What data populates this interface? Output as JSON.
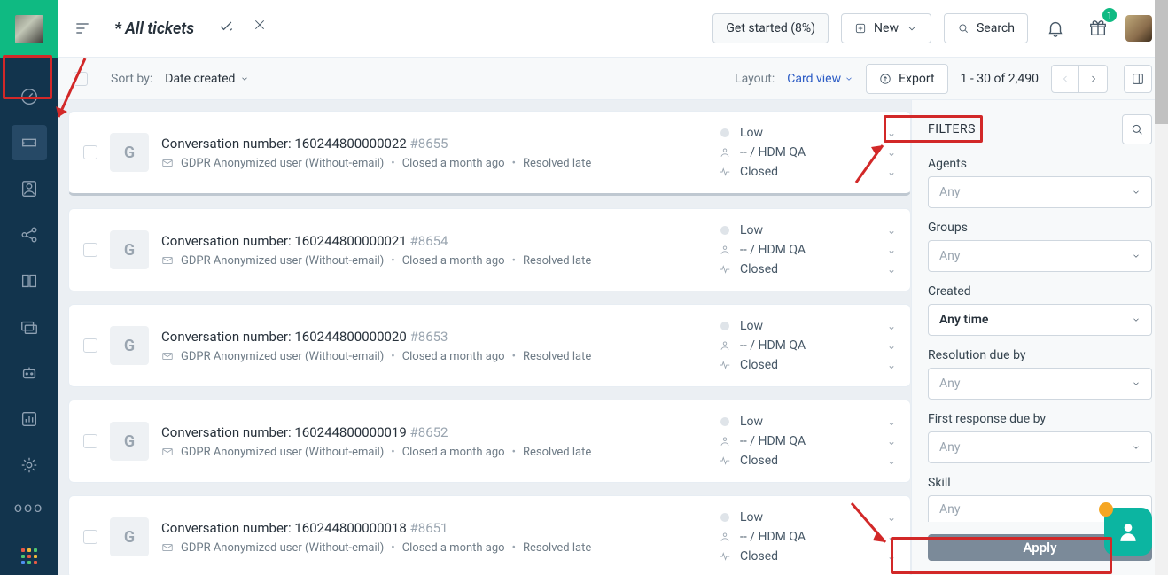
{
  "header": {
    "page_title": "* All tickets",
    "get_started_label": "Get started (8%)",
    "new_label": "New",
    "search_label": "Search",
    "gift_badge": "1"
  },
  "toolbar": {
    "sort_label": "Sort by:",
    "sort_value": "Date created",
    "layout_label": "Layout:",
    "layout_value": "Card view",
    "export_label": "Export",
    "pager": "1 - 30 of 2,490"
  },
  "filters": {
    "title": "FILTERS",
    "agents": {
      "label": "Agents",
      "value": "Any"
    },
    "groups": {
      "label": "Groups",
      "value": "Any"
    },
    "created": {
      "label": "Created",
      "value": "Any time"
    },
    "resolution": {
      "label": "Resolution due by",
      "value": "Any"
    },
    "first_response": {
      "label": "First response due by",
      "value": "Any"
    },
    "skill": {
      "label": "Skill",
      "value": "Any"
    },
    "apply_label": "Apply"
  },
  "ticket_shared": {
    "title_prefix": "Conversation number: ",
    "avatar_letter": "G",
    "contact": "GDPR Anonymized user (Without-email)",
    "status_text": "Closed a month ago",
    "sla_text": "Resolved late",
    "priority": "Low",
    "agent": "-- / HDM QA",
    "state": "Closed"
  },
  "tickets": [
    {
      "conv": "160244800000022",
      "id": "#8655"
    },
    {
      "conv": "160244800000021",
      "id": "#8654"
    },
    {
      "conv": "160244800000020",
      "id": "#8653"
    },
    {
      "conv": "160244800000019",
      "id": "#8652"
    },
    {
      "conv": "160244800000018",
      "id": "#8651"
    }
  ]
}
